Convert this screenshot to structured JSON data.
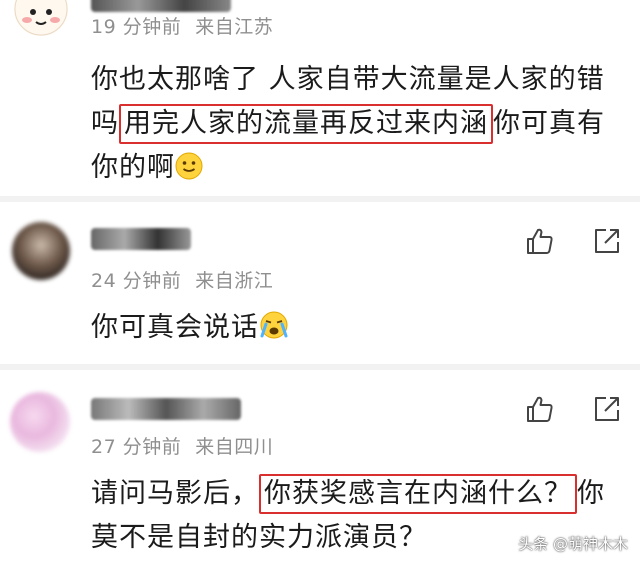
{
  "comments": [
    {
      "time": "19 分钟前",
      "location": "来自江苏",
      "text_before": "你也太那啥了 人家自带大流量是人家的错吗",
      "text_highlight": "用完人家的流量再反过来内涵",
      "text_after": "你可真有你的啊",
      "emoji": "slight-smile-emoji"
    },
    {
      "time": "24 分钟前",
      "location": "来自浙江",
      "text": "你可真会说话",
      "emoji": "crying-emoji"
    },
    {
      "time": "27 分钟前",
      "location": "来自四川",
      "text_before": "请问马影后，",
      "text_highlight": "你获奖感言在内涵什么？",
      "text_after": "你莫不是自封的实力派演员？"
    }
  ],
  "actions": {
    "like_icon": "thumbs-up-icon",
    "share_icon": "share-icon"
  },
  "watermark": "头条 @萌神木木",
  "colors": {
    "highlight_border": "#d92f2f",
    "meta_text": "#8f8f8f",
    "body_text": "#1b1b1b"
  }
}
